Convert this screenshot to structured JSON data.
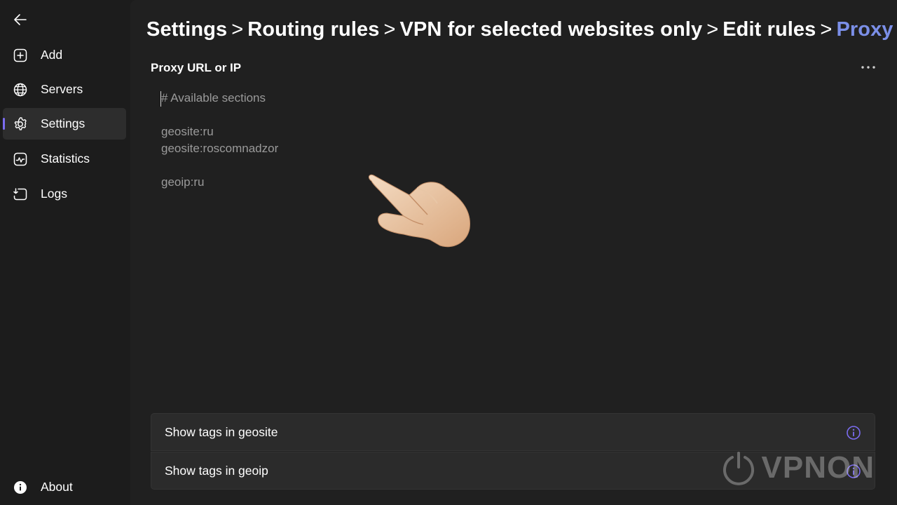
{
  "sidebar": {
    "items": [
      {
        "label": "Add",
        "icon": "add-square-icon"
      },
      {
        "label": "Servers",
        "icon": "globe-icon"
      },
      {
        "label": "Settings",
        "icon": "gear-icon",
        "active": true
      },
      {
        "label": "Statistics",
        "icon": "chart-icon"
      },
      {
        "label": "Logs",
        "icon": "logs-icon"
      }
    ],
    "about": {
      "label": "About",
      "icon": "info-icon"
    }
  },
  "breadcrumb": {
    "items": [
      "Settings",
      "Routing rules",
      "VPN for selected websites only",
      "Edit rules"
    ],
    "separator": ">",
    "current": "Proxy"
  },
  "section": {
    "label": "Proxy URL or IP"
  },
  "editor": {
    "lines": [
      "# Available sections",
      "geosite:ru",
      "geosite:roscomnadzor",
      "geoip:ru"
    ]
  },
  "actions": [
    {
      "label": "Show tags in geosite",
      "icon": "info-icon"
    },
    {
      "label": "Show tags in geoip",
      "icon": "info-icon"
    }
  ],
  "watermark": {
    "text": "VPNON"
  },
  "colors": {
    "accent": "#7b6cf0",
    "breadcrumb_current": "#7b8fe8",
    "background": "#202020",
    "sidebar": "#1c1c1c"
  }
}
